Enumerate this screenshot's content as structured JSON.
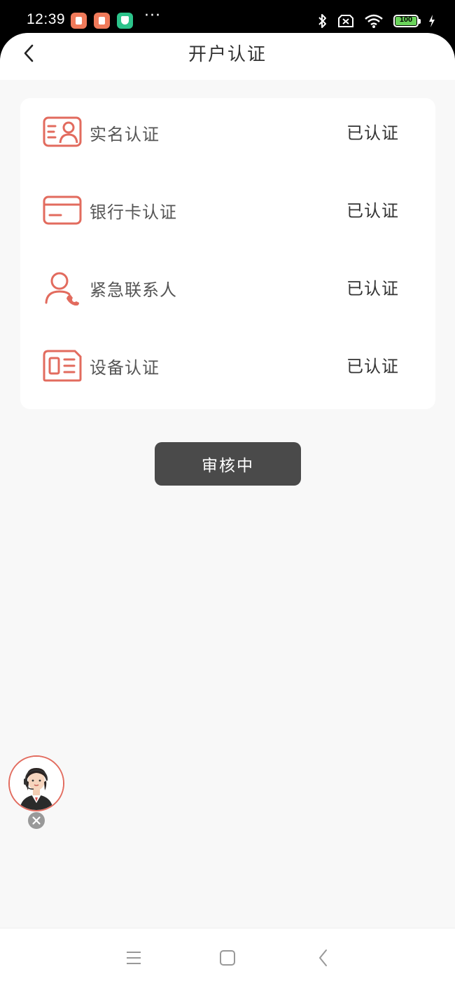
{
  "status_bar": {
    "time": "12:39",
    "dots": "···",
    "battery": "100"
  },
  "header": {
    "title": "开户认证"
  },
  "verification": {
    "items": [
      {
        "label": "实名认证",
        "status": "已认证",
        "icon": "id-card-icon"
      },
      {
        "label": "银行卡认证",
        "status": "已认证",
        "icon": "bank-card-icon"
      },
      {
        "label": "紧急联系人",
        "status": "已认证",
        "icon": "emergency-contact-icon"
      },
      {
        "label": "设备认证",
        "status": "已认证",
        "icon": "device-icon"
      }
    ]
  },
  "review_button": {
    "label": "审核中"
  },
  "colors": {
    "icon_accent": "#e26b5e",
    "button_bg": "#4a4a4a",
    "page_bg": "#f8f8f8"
  }
}
